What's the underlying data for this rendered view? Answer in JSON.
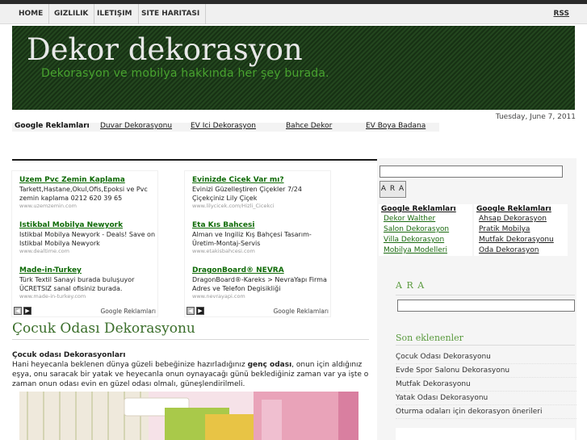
{
  "nav": {
    "items": [
      "HOME",
      "GIZLILIK",
      "ILETIŞIM",
      "SITE HARITASI"
    ],
    "rss": "RSS"
  },
  "header": {
    "title": "Dekor dekorasyon",
    "tagline": "Dekorasyon ve mobilya hakkında her şey burada."
  },
  "date": "Tuesday, June 7, 2011",
  "linkbar": {
    "heading": "Google Reklamları",
    "links": [
      "Duvar Dekorasyonu",
      "EV Ici Dekorasyon",
      "Bahce Dekor",
      "EV Boya Badana"
    ]
  },
  "ads_left": {
    "items": [
      {
        "title": "Uzem Pvc Zemin Kaplama",
        "text": "Tarkett,Hastane,Okul,Ofis,Epoksi ve Pvc zemin kaplama 0212 620 39 65",
        "url": "www.uzemzemin.com"
      },
      {
        "title": "Istikbal Mobilya Newyork",
        "text": "Istikbal Mobilya Newyork - Deals! Save on Istikbal Mobilya Newyork",
        "url": "www.dealtime.com"
      },
      {
        "title": "Made-in-Turkey",
        "text": "Türk Textil Sanayi burada buluşuyor ÜCRETSIZ sanal ofisiniz burada.",
        "url": "www.made-in-turkey.com"
      }
    ],
    "brand": "Google Reklamları"
  },
  "ads_right": {
    "items": [
      {
        "title": "Evinizde Cicek Var mı?",
        "text": "Evinizi Güzelleştiren Çiçekler 7/24 Çiçekçiniz Lily Çiçek",
        "url": "www.lilycicek.com/Hizli_Cicekci"
      },
      {
        "title": "Eta Kıs Bahcesi",
        "text": "Alman ve Ingiliz Kış Bahçesi Tasarım-Üretim-Montaj-Servis",
        "url": "www.etakisbahcesi.com"
      },
      {
        "title": "DragonBoard® NEVRA",
        "text": "DragonBoard®-Kareks > NevraYapı Firma Adres ve Telefon Degisikliği",
        "url": "www.nevrayapi.com"
      }
    ],
    "brand": "Google Reklamları"
  },
  "post": {
    "title": "Çocuk Odası Dekorasyonu",
    "subtitle": "Çocuk odası Dekorasyonları",
    "body_before": "Hani heyecanla beklenen dünya güzeli bebeğinize hazırladığınız ",
    "body_bold": "genç odası",
    "body_after": ", onun için aldığınız eşya, onu saracak bir yatak ve heyecanla onun oynayacağı günü beklediğiniz zaman var ya işte o zaman onun odası evin en güzel odası olmalı, güneşlendirilmeli."
  },
  "sidebar": {
    "search_button": "A R A",
    "links_left": {
      "heading": "Google Reklamları",
      "items": [
        "Dekor Walther",
        "Salon Dekorasyon",
        "Villa Dekorasyon",
        "Mobilya Modelleri"
      ]
    },
    "links_right": {
      "heading": "Google Reklamları",
      "items": [
        "Ahsap Dekorasyon",
        "Pratik Mobilya",
        "Mutfak Dekorasyonu",
        "Oda Dekorasyon"
      ]
    },
    "search_heading": "A R A",
    "recent_heading": "Son eklenenler",
    "recent": [
      "Çocuk Odası Dekorasyonu",
      "Evde Spor Salonu Dekorasyonu",
      "Mutfak Dekorasyonu",
      "Yatak Odası Dekorasyonu",
      "Oturma odaları için dekorasyon önerileri"
    ]
  },
  "colors": {
    "header_bg": "#1f3d1a",
    "tagline": "#48a32f",
    "ad_title": "#0e6a06",
    "post_title": "#3a6e2a"
  }
}
